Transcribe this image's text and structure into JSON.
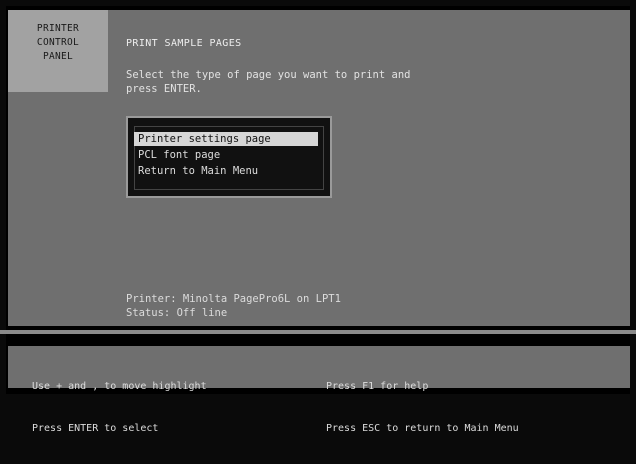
{
  "panel_title": [
    "PRINTER",
    "CONTROL",
    "PANEL"
  ],
  "heading": "PRINT SAMPLE PAGES",
  "instructions": [
    "Select the type of page you want to print and",
    "press ENTER."
  ],
  "menu": {
    "items": [
      {
        "label": "Printer settings page",
        "selected": true
      },
      {
        "label": "PCL font page",
        "selected": false
      },
      {
        "label": "Return to Main Menu",
        "selected": false
      }
    ]
  },
  "printer_info": {
    "printer_line": "Printer: Minolta PagePro6L on LPT1",
    "status_line": "Status:  Off line"
  },
  "help": {
    "left": [
      "Use + and , to move highlight",
      "Press ENTER to select"
    ],
    "right": [
      "Press F1 for help",
      "Press ESC to return to Main Menu"
    ]
  }
}
